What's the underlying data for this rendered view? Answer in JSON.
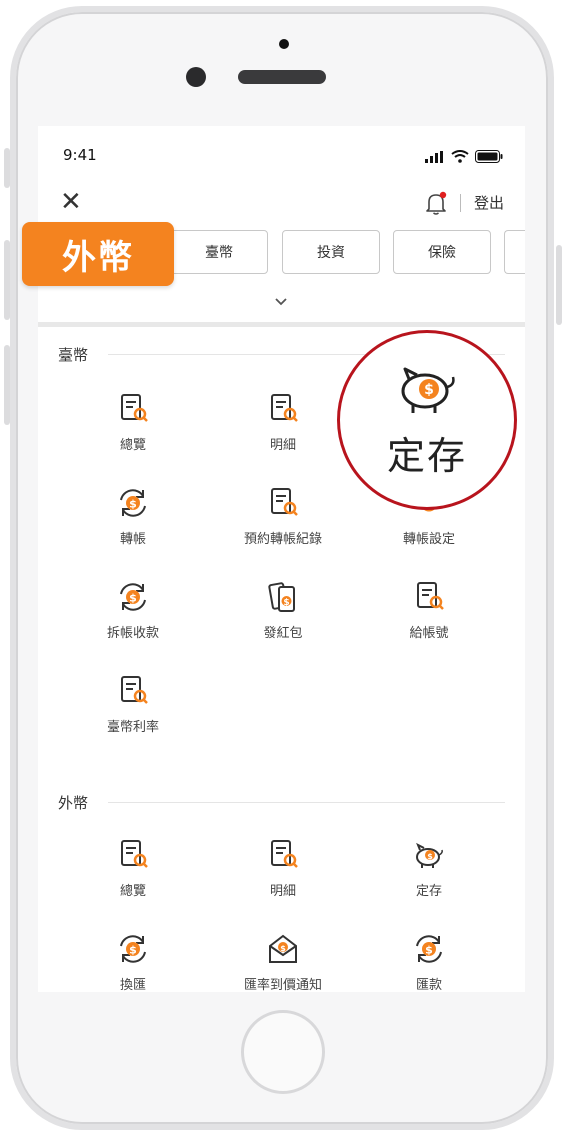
{
  "status_bar": {
    "time": "9:41"
  },
  "header": {
    "logout_label": "登出"
  },
  "tabs": [
    {
      "label": "外幣",
      "active": true
    },
    {
      "label": "臺幣"
    },
    {
      "label": "投資"
    },
    {
      "label": "保險"
    }
  ],
  "sections": [
    {
      "title": "臺幣",
      "items": [
        {
          "label": "總覽",
          "icon": "doc-search-icon"
        },
        {
          "label": "明細",
          "icon": "doc-search-icon"
        },
        {
          "label": "定存",
          "icon": "piggy-bank-icon"
        },
        {
          "label": "轉帳",
          "icon": "transfer-icon"
        },
        {
          "label": "預約轉帳紀錄",
          "icon": "doc-search-icon"
        },
        {
          "label": "轉帳設定",
          "icon": "gear-icon"
        },
        {
          "label": "拆帳收款",
          "icon": "transfer-icon"
        },
        {
          "label": "發紅包",
          "icon": "red-envelope-icon"
        },
        {
          "label": "給帳號",
          "icon": "doc-search-icon"
        },
        {
          "label": "臺幣利率",
          "icon": "doc-search-icon"
        }
      ]
    },
    {
      "title": "外幣",
      "items": [
        {
          "label": "總覽",
          "icon": "doc-search-icon"
        },
        {
          "label": "明細",
          "icon": "doc-search-icon"
        },
        {
          "label": "定存",
          "icon": "piggy-bank-icon"
        },
        {
          "label": "換匯",
          "icon": "transfer-icon"
        },
        {
          "label": "匯率到價通知",
          "icon": "mail-dollar-icon"
        },
        {
          "label": "匯款",
          "icon": "transfer-icon"
        }
      ]
    }
  ],
  "callout": {
    "label": "定存",
    "icon": "piggy-bank-icon"
  },
  "colors": {
    "accent": "#f4831f",
    "callout_ring": "#b8141d",
    "icon_dark": "#333333"
  }
}
